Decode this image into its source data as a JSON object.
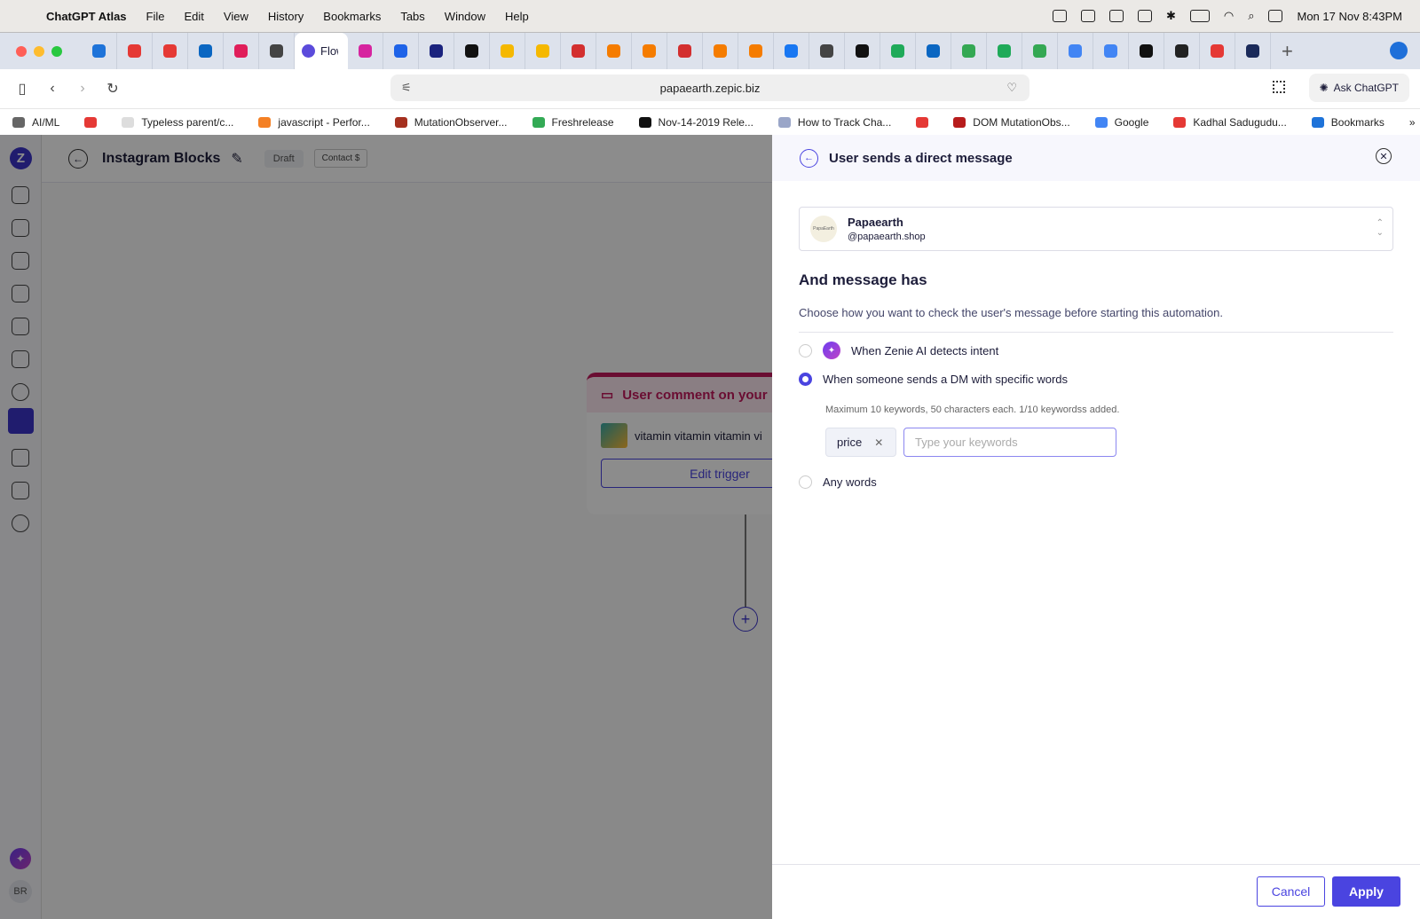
{
  "menubar": {
    "app_name": "ChatGPT Atlas",
    "items": [
      "File",
      "Edit",
      "View",
      "History",
      "Bookmarks",
      "Tabs",
      "Window",
      "Help"
    ],
    "clock": "Mon 17 Nov  8:43PM"
  },
  "tabs": {
    "active_label": "Flow",
    "icon_colors": [
      "#1e73d9",
      "#e53935",
      "#e53935",
      "#0a66c2",
      "#e01e5a",
      "#444444",
      "#5b4bdb",
      "#d6249f",
      "#1e63e8",
      "#1a237e",
      "#111111",
      "#f5b800",
      "#f5b800",
      "#d32f2f",
      "#f57c00",
      "#f57c00",
      "#d32f2f",
      "#f57c00",
      "#f57c00",
      "#1877f2",
      "#444444",
      "#111111",
      "#1faa59",
      "#0a66c2",
      "#34a853",
      "#1faa59",
      "#34a853",
      "#4285f4",
      "#4285f4",
      "#111111",
      "#222222",
      "#e53935",
      "#1a2a5a"
    ]
  },
  "address": {
    "url": "papaearth.zepic.biz",
    "ask_label": "Ask ChatGPT"
  },
  "bookmarks": [
    {
      "label": "AI/ML",
      "color": "#666666"
    },
    {
      "label": "",
      "color": "#e53935"
    },
    {
      "label": "Typeless parent/c...",
      "color": "#dddddd"
    },
    {
      "label": "javascript - Perfor...",
      "color": "#f48024"
    },
    {
      "label": "MutationObserver...",
      "color": "#a5301f"
    },
    {
      "label": "Freshrelease",
      "color": "#33aa55"
    },
    {
      "label": "Nov-14-2019 Rele...",
      "color": "#111111"
    },
    {
      "label": "How to Track Cha...",
      "color": "#9aa6c8"
    },
    {
      "label": "",
      "color": "#e53935"
    },
    {
      "label": "DOM MutationObs...",
      "color": "#b71c1c"
    },
    {
      "label": "Google",
      "color": "#4285f4"
    },
    {
      "label": "Kadhal Sadugudu...",
      "color": "#e53935"
    },
    {
      "label": "Bookmarks",
      "color": "#1e73d9"
    }
  ],
  "app": {
    "logo": "Z",
    "avatar": "BR",
    "title": "Instagram Blocks",
    "status": "Draft",
    "contact_label": "Contact",
    "node": {
      "title": "User comment on your",
      "post_text": "vitamin vitamin vitamin vi",
      "edit_label": "Edit trigger"
    }
  },
  "panel": {
    "title": "User sends a direct message",
    "account": {
      "name": "Papaearth",
      "handle": "@papaearth.shop",
      "logo_text": "PapaEarth"
    },
    "heading": "And message has",
    "description": "Choose how you want to check the user's message before starting this automation.",
    "options": [
      {
        "label": "When Zenie AI detects intent",
        "selected": false
      },
      {
        "label": "When someone sends a DM with specific words",
        "selected": true
      },
      {
        "label": "Any words",
        "selected": false
      }
    ],
    "hint": "Maximum 10 keywords, 50 characters each. 1/10 keywordss added.",
    "keywords": [
      "price"
    ],
    "keyword_placeholder": "Type your keywords",
    "cancel_label": "Cancel",
    "apply_label": "Apply"
  }
}
